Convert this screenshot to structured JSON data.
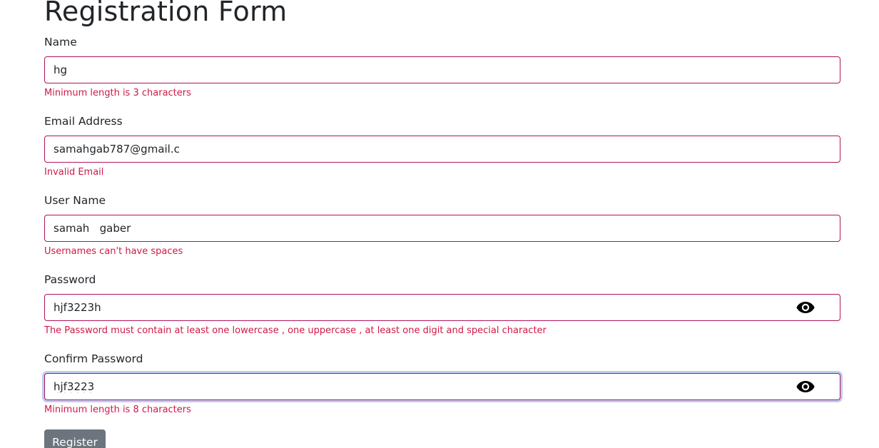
{
  "form": {
    "title": "Registration Form",
    "fields": [
      {
        "label": "Name",
        "value": "hg",
        "error": "Minimum length is 3 characters"
      },
      {
        "label": "Email Address",
        "value": "samahgab787@gmail.c",
        "error": "Invalid Email"
      },
      {
        "label": "User Name",
        "value": "samah   gaber",
        "error": "Usernames can't have spaces"
      },
      {
        "label": "Password",
        "value": "hjf3223h",
        "error": "The Password must contain at least one lowercase , one uppercase , at least one digit and special character",
        "icon": "eye-icon"
      },
      {
        "label": "Confirm Password",
        "value": "hjf3223",
        "error": "Minimum length is 8 characters",
        "icon": "eye-icon"
      }
    ],
    "submit_label": "Register"
  },
  "colors": {
    "invalid_border": "#b0155b",
    "error_text": "#d11846",
    "button_bg": "#6c757d",
    "focus_ring": "#b0c4f0"
  }
}
